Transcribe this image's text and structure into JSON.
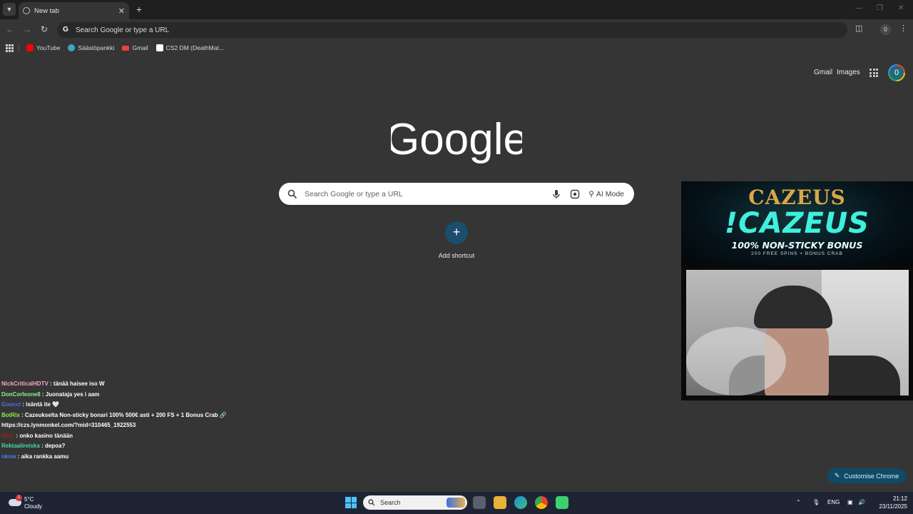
{
  "browser": {
    "tab_title": "New tab",
    "omnibox_text": "Search Google or type a URL",
    "profile_initial": "0",
    "bookmarks": [
      {
        "label": "YouTube",
        "icon": "youtube-icon",
        "color": "#ff0000"
      },
      {
        "label": "Säästöpankki",
        "icon": "saastopankki-icon",
        "color": "#3aa7c9"
      },
      {
        "label": "Gmail",
        "icon": "gmail-icon",
        "color": "#ea4335"
      },
      {
        "label": "CS2 DM (DeathMat...",
        "icon": "cs2-icon",
        "color": "#ffffff"
      }
    ]
  },
  "page": {
    "top_links": {
      "gmail": "Gmail",
      "images": "Images"
    },
    "avatar_initial": "0",
    "search_placeholder": "Search Google or type a URL",
    "ai_mode_label": "AI Mode",
    "add_shortcut_label": "Add shortcut",
    "customise_label": "Customise Chrome"
  },
  "overlay": {
    "chat": [
      {
        "user": "NickCriticalHDTV",
        "user_color": "#f4a6c8",
        "message": ": tänää haisee iso W"
      },
      {
        "user": "DonCorleone8",
        "user_color": "#8ff08f",
        "message": ": Juonataja yes i aam"
      },
      {
        "user": "Goucci",
        "user_color": "#4a6ef0",
        "message": ": isäntä ite 🤍"
      },
      {
        "user": "BotRix",
        "user_color": "#8ff04a",
        "message": ": Cazeukselta Non-sticky bonari 100% 500€ asti + 200 FS + 1 Bonus Crab 🔗 https://czs.lynmonkel.com/?mid=310465_1922553"
      },
      {
        "user": "Miljo",
        "user_color": "#9b1c1c",
        "message": ": onko kasino tänään"
      },
      {
        "user": "Rektaalireiska",
        "user_color": "#4ad8a0",
        "message": ": depoa?"
      },
      {
        "user": "nkow",
        "user_color": "#4a7ef0",
        "message": ": aika rankka aamu"
      }
    ],
    "banner": {
      "brand": "CAZEUS",
      "headline": "!CAZEUS",
      "promo": "100% NON-STICKY BONUS",
      "sub": "200 FREE SPINS + BONUS CRAB"
    }
  },
  "taskbar": {
    "weather_temp": "5°C",
    "weather_cond": "Cloudy",
    "weather_badge": "1",
    "search_label": "Search",
    "lang": "ENG",
    "time": "21:12",
    "date": "23/11/2025"
  }
}
